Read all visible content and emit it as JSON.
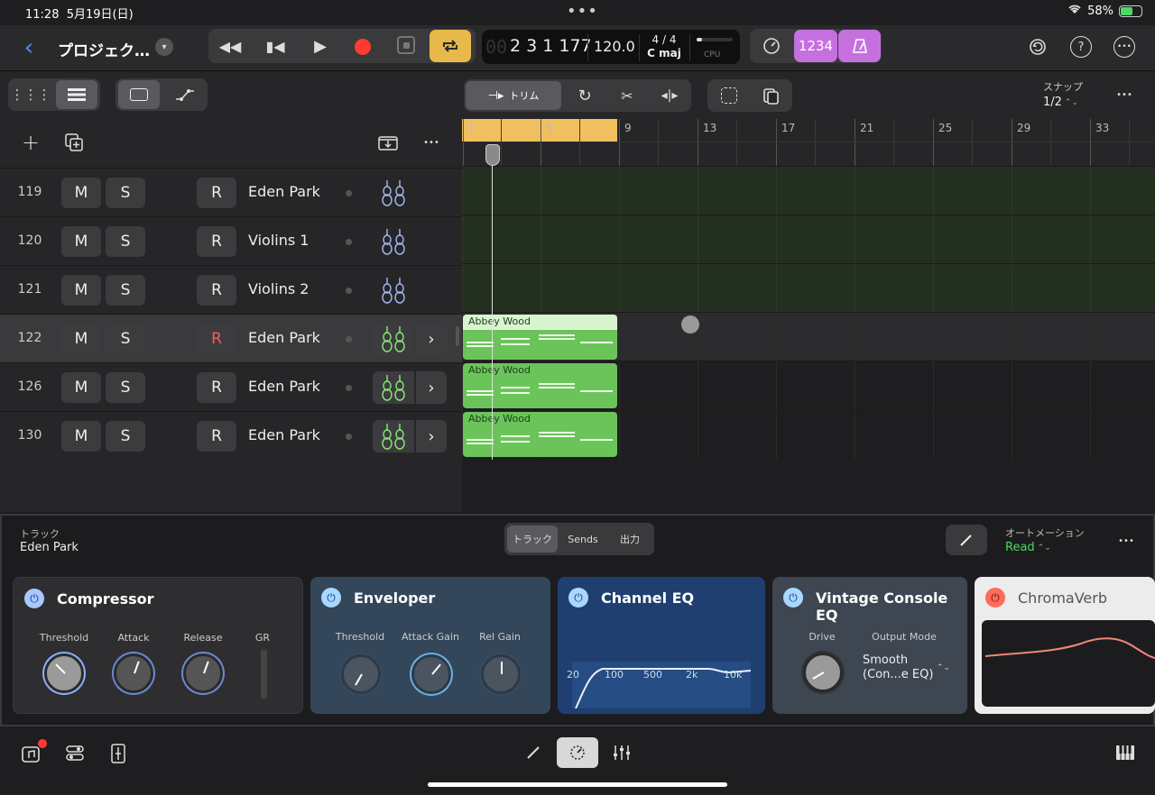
{
  "status": {
    "time": "11:28",
    "date": "5月19日(日)",
    "battery": "58%"
  },
  "header": {
    "project_title": "プロジェク…",
    "position": "2 3 1 177",
    "position_ghost": "00",
    "tempo": "120.0",
    "signature": "4 / 4",
    "key": "C maj",
    "cpu": "CPU",
    "count_in": "1234"
  },
  "toolbar": {
    "trim_label": "トリム",
    "snap_label": "スナップ",
    "snap_value": "1/2"
  },
  "ruler": {
    "bars": [
      "1",
      "5",
      "9",
      "13",
      "17",
      "21",
      "25",
      "29",
      "33"
    ]
  },
  "tracks": [
    {
      "num": "119",
      "name": "Eden Park",
      "mute": "M",
      "solo": "S",
      "rec": "R"
    },
    {
      "num": "120",
      "name": "Violins 1",
      "mute": "M",
      "solo": "S",
      "rec": "R"
    },
    {
      "num": "121",
      "name": "Violins 2",
      "mute": "M",
      "solo": "S",
      "rec": "R"
    },
    {
      "num": "122",
      "name": "Eden Park",
      "mute": "M",
      "solo": "S",
      "rec": "R"
    },
    {
      "num": "126",
      "name": "Eden Park",
      "mute": "M",
      "solo": "S",
      "rec": "R"
    },
    {
      "num": "130",
      "name": "Eden Park",
      "mute": "M",
      "solo": "S",
      "rec": "R"
    }
  ],
  "regions": [
    {
      "name": "Abbey Wood"
    },
    {
      "name": "Abbey Wood"
    },
    {
      "name": "Abbey Wood"
    }
  ],
  "inspector": {
    "track_label": "トラック",
    "track_name": "Eden Park",
    "tabs": [
      "トラック",
      "Sends",
      "出力"
    ],
    "automation_label": "オートメーション",
    "automation_value": "Read",
    "plugins": {
      "compressor": {
        "title": "Compressor",
        "knobs": [
          "Threshold",
          "Attack",
          "Release"
        ],
        "gr": "GR"
      },
      "enveloper": {
        "title": "Enveloper",
        "knobs": [
          "Threshold",
          "Attack Gain",
          "Rel Gain"
        ]
      },
      "channel_eq": {
        "title": "Channel EQ",
        "freqs": [
          "20",
          "100",
          "500",
          "2k",
          "10k"
        ]
      },
      "vintage": {
        "title": "Vintage Console EQ",
        "drive": "Drive",
        "output_mode": "Output Mode",
        "mode_value_1": "Smooth",
        "mode_value_2": "(Con...e EQ)"
      },
      "chromaverb": {
        "title": "ChromaVerb"
      }
    }
  },
  "colors": {
    "accent_blue": "#0a84ff",
    "loop_yellow": "#e6b94a",
    "record_red": "#ff3b30",
    "purple": "#c670e0",
    "region_green": "#6bc45a"
  }
}
